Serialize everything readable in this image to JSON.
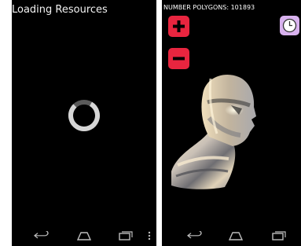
{
  "loading_screen": {
    "title": "Loading Resources"
  },
  "viewer_screen": {
    "polygon_label": "NUMBER POLYGONS: 101893",
    "zoom_in_icon": "plus-icon",
    "zoom_out_icon": "minus-icon",
    "timer_icon": "clock-icon",
    "model": "3d-head-bust"
  },
  "navbar": {
    "icons": [
      "back-icon",
      "home-icon",
      "recents-icon",
      "menu-icon"
    ]
  },
  "colors": {
    "screen_bg": "#000000",
    "zoom_button": "#e8253f",
    "timer_button": "#d8b2ee",
    "nav_icon": "#bdbdbd"
  }
}
